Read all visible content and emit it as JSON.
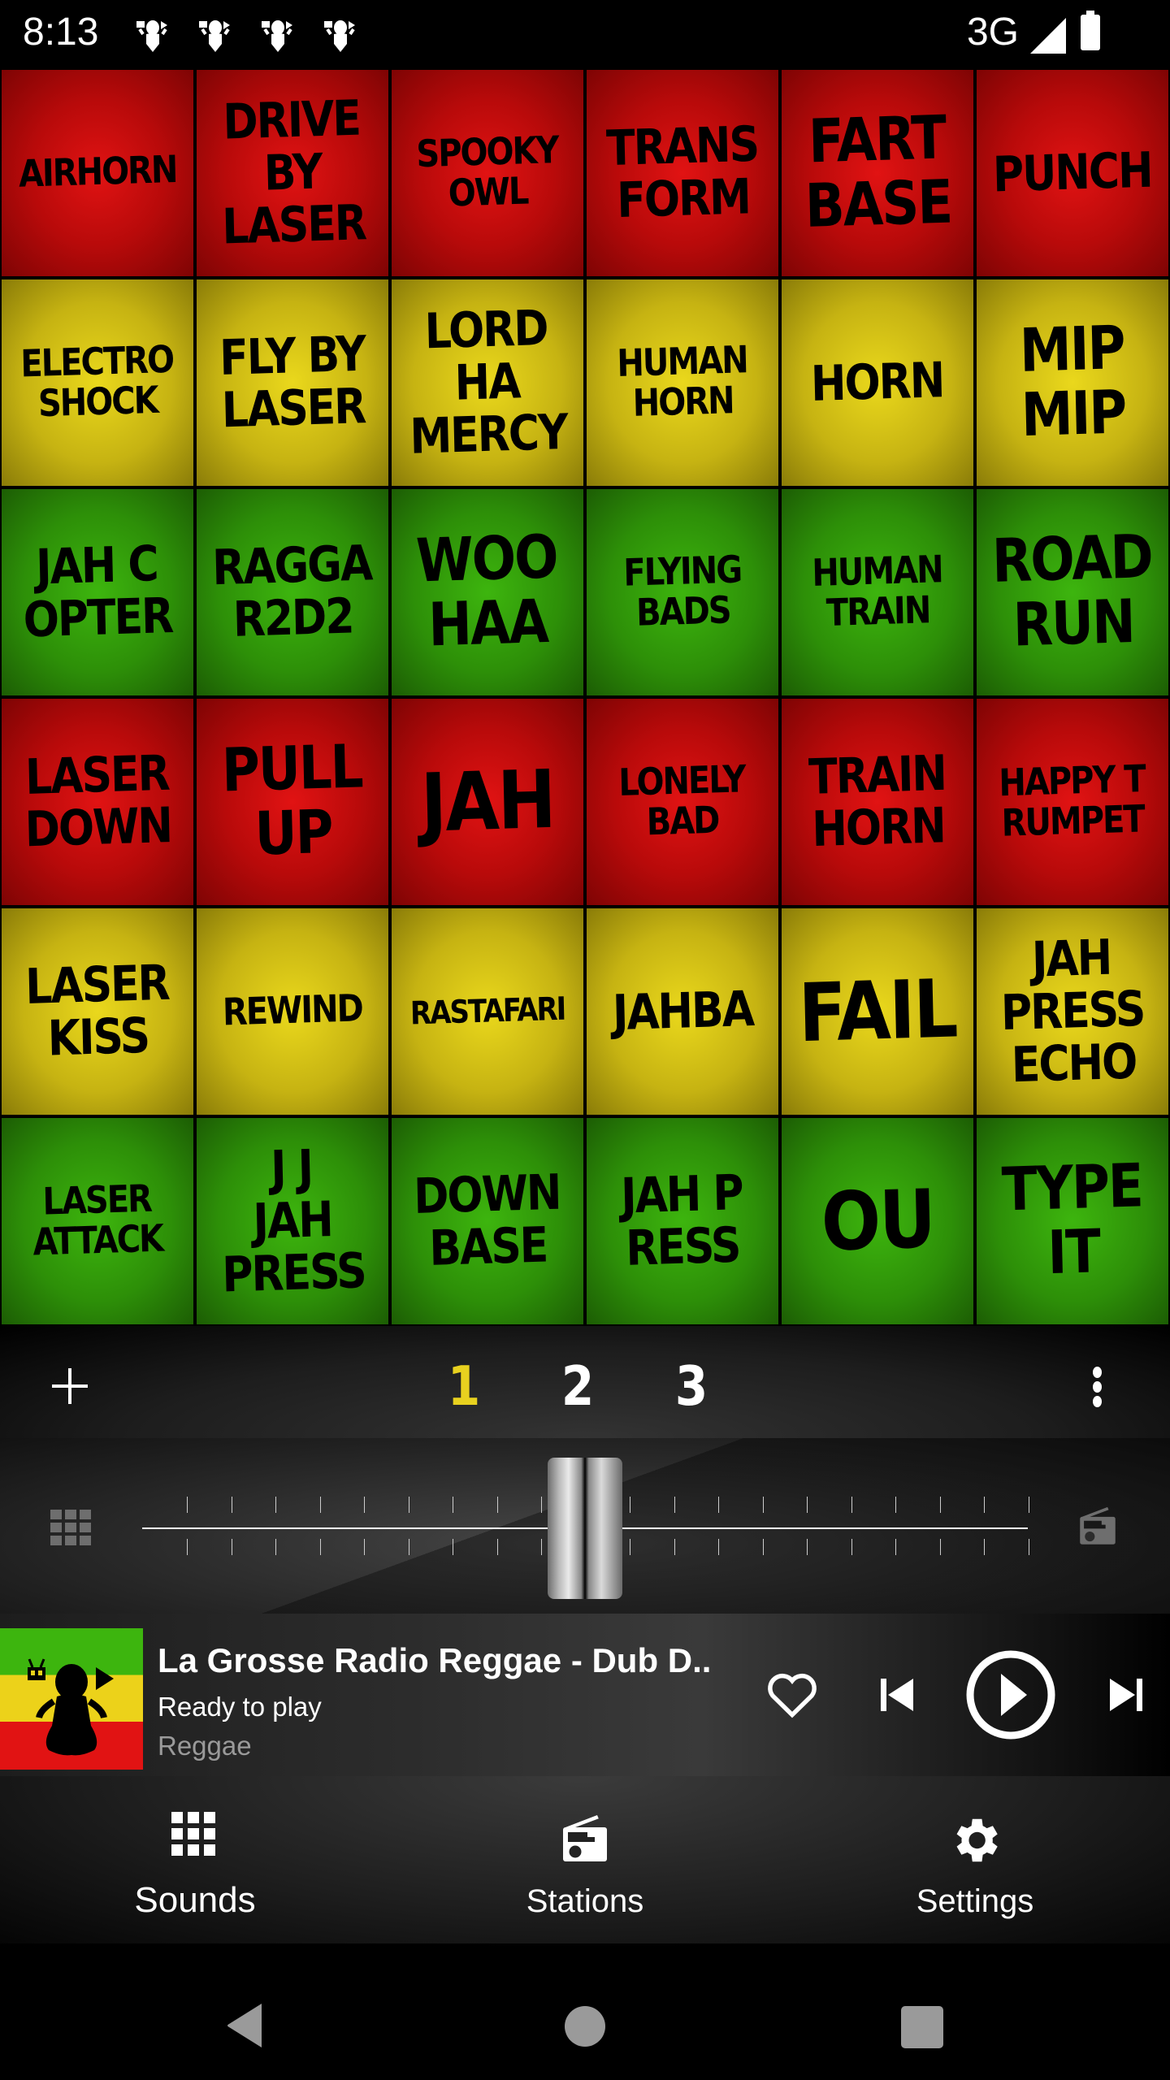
{
  "status_bar": {
    "time": "8:13",
    "notification_icons": [
      "rasta-frog-icon",
      "rasta-frog-icon",
      "rasta-frog-icon",
      "rasta-frog-icon"
    ],
    "network": "3G",
    "signal_icon": "signal-icon",
    "battery_icon": "battery-icon"
  },
  "colors": {
    "red": "#c80d0d",
    "yellow": "#d6c116",
    "green": "#35a30b",
    "active_page": "#e8d11f",
    "background": "#000000"
  },
  "sound_grid": {
    "rows": [
      {
        "color": "red",
        "tiles": [
          {
            "label": "AIRHORN",
            "size": "s"
          },
          {
            "label": "DRIVE\nBY\nLASER",
            "size": "m"
          },
          {
            "label": "SPOOKY\nOWL",
            "size": "s"
          },
          {
            "label": "TRANS\nFORM",
            "size": "m"
          },
          {
            "label": "FART\nBASE",
            "size": "l"
          },
          {
            "label": "PUNCH",
            "size": "m"
          }
        ]
      },
      {
        "color": "yellow",
        "tiles": [
          {
            "label": "ELECTRO\nSHOCK",
            "size": "s"
          },
          {
            "label": "FLY BY\nLASER",
            "size": "m"
          },
          {
            "label": "LORD\nHA\nMERCY",
            "size": "m"
          },
          {
            "label": "HUMAN\nHORN",
            "size": "s"
          },
          {
            "label": "HORN",
            "size": "m"
          },
          {
            "label": "MIP\nMIP",
            "size": "l"
          }
        ]
      },
      {
        "color": "green",
        "tiles": [
          {
            "label": "JAH C\nOPTER",
            "size": "m"
          },
          {
            "label": "RAGGA\nR2D2",
            "size": "m"
          },
          {
            "label": "WOO\nHAA",
            "size": "l"
          },
          {
            "label": "FLYING\nBADS",
            "size": "s"
          },
          {
            "label": "HUMAN\nTRAIN",
            "size": "s"
          },
          {
            "label": "ROAD\nRUN",
            "size": "l"
          }
        ]
      },
      {
        "color": "red",
        "tiles": [
          {
            "label": "LASER\nDOWN",
            "size": "m"
          },
          {
            "label": "PULL\nUP",
            "size": "l"
          },
          {
            "label": "JAH",
            "size": "xl"
          },
          {
            "label": "LONELY\nBAD",
            "size": "s"
          },
          {
            "label": "TRAIN\nHORN",
            "size": "m"
          },
          {
            "label": "HAPPY T\nRUMPET",
            "size": "s"
          }
        ]
      },
      {
        "color": "yellow",
        "tiles": [
          {
            "label": "LASER\nKISS",
            "size": "m"
          },
          {
            "label": "REWIND",
            "size": "s"
          },
          {
            "label": "RASTAFARI",
            "size": "xs"
          },
          {
            "label": "JAHBA",
            "size": "m"
          },
          {
            "label": "FAIL",
            "size": "xl"
          },
          {
            "label": "JAH\nPRESS\nECHO",
            "size": "m"
          }
        ]
      },
      {
        "color": "green",
        "tiles": [
          {
            "label": "LASER\nATTACK",
            "size": "s"
          },
          {
            "label": "J J\nJAH\nPRESS",
            "size": "m"
          },
          {
            "label": "DOWN\nBASE",
            "size": "m"
          },
          {
            "label": "JAH P\nRESS",
            "size": "m"
          },
          {
            "label": "OU",
            "size": "xl"
          },
          {
            "label": "TYPE\nIT",
            "size": "l"
          }
        ]
      }
    ]
  },
  "control_bar": {
    "add_icon": "plus-icon",
    "pages": [
      "1",
      "2",
      "3"
    ],
    "active_page": "1",
    "more_icon": "more-vert-icon"
  },
  "crossfader": {
    "left_icon": "grid-icon",
    "right_icon": "radio-icon",
    "position": 0.5
  },
  "player": {
    "station_title": "La Grosse Radio Reggae - Dub D..",
    "status": "Ready to play",
    "genre": "Reggae",
    "favorite_icon": "heart-outline-icon",
    "prev_icon": "skip-previous-icon",
    "play_icon": "play-circle-icon",
    "next_icon": "skip-next-icon"
  },
  "bottom_nav": {
    "items": [
      {
        "label": "Sounds",
        "icon": "grid-icon",
        "active": true
      },
      {
        "label": "Stations",
        "icon": "radio-icon",
        "active": false
      },
      {
        "label": "Settings",
        "icon": "gear-icon",
        "active": false
      }
    ]
  },
  "system_nav": {
    "back_icon": "back-icon",
    "home_icon": "home-icon",
    "recents_icon": "recents-icon"
  }
}
